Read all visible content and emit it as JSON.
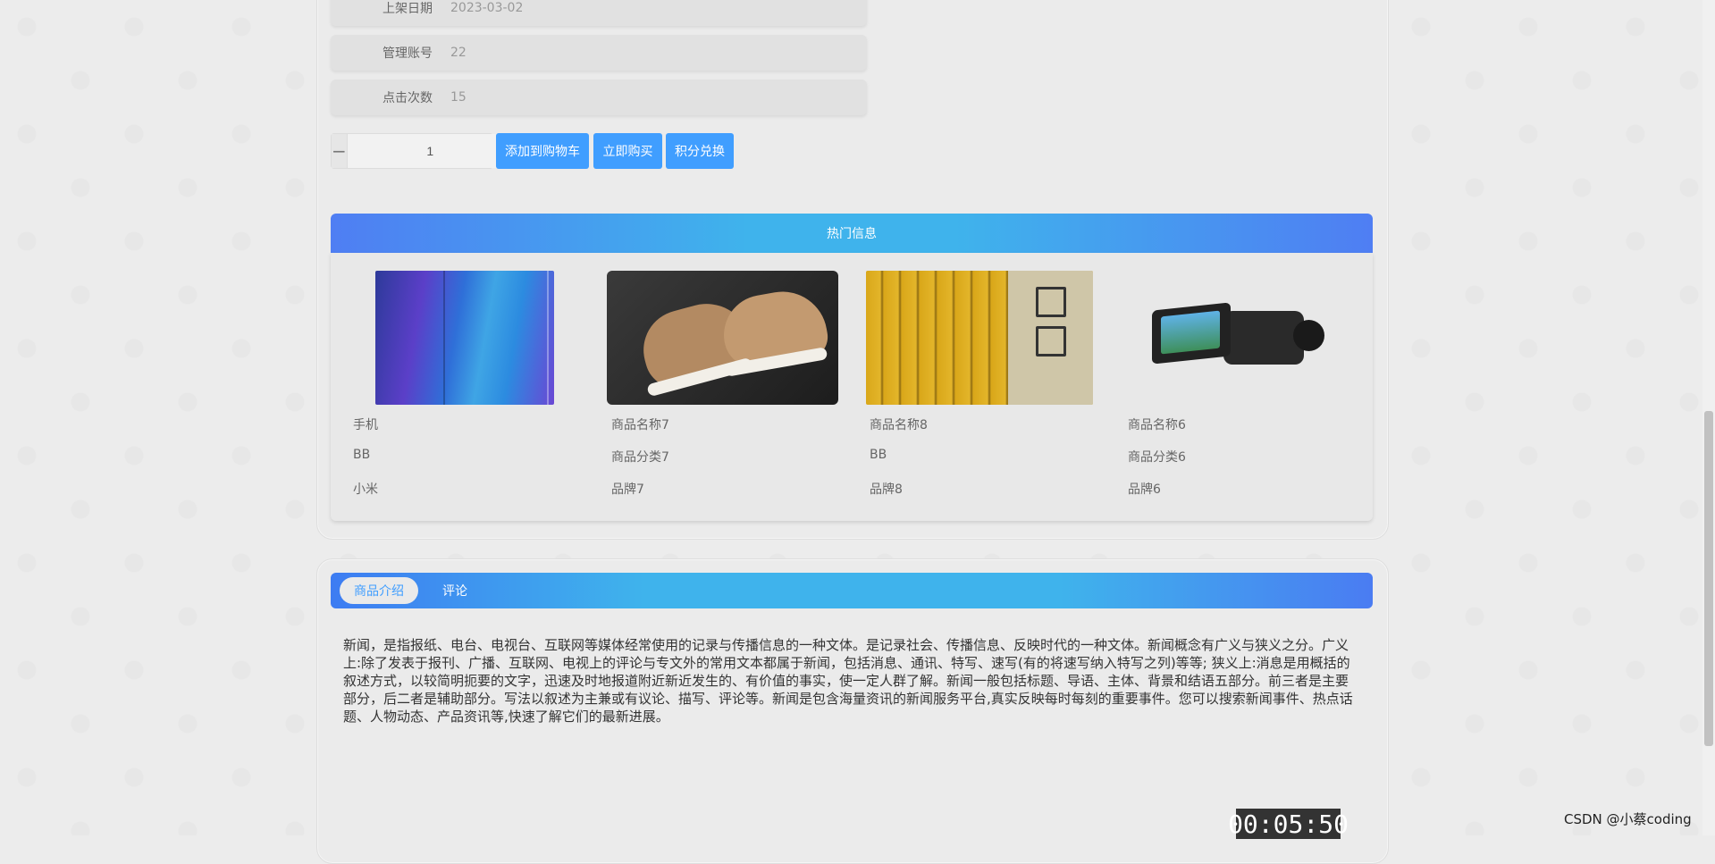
{
  "attributes": [
    {
      "label": "上架日期",
      "value": "2023-03-02"
    },
    {
      "label": "管理账号",
      "value": "22"
    },
    {
      "label": "点击次数",
      "value": "15"
    }
  ],
  "purchase": {
    "quantity": "1",
    "minus": "−",
    "plus": "+",
    "add_to_cart": "添加到购物车",
    "buy_now": "立即购买",
    "points_exchange": "积分兑换"
  },
  "hot": {
    "title": "热门信息",
    "items": [
      {
        "name": "手机",
        "category": "BB",
        "brand": "小米"
      },
      {
        "name": "商品名称7",
        "category": "商品分类7",
        "brand": "品牌7"
      },
      {
        "name": "商品名称8",
        "category": "BB",
        "brand": "品牌8"
      },
      {
        "name": "商品名称6",
        "category": "商品分类6",
        "brand": "品牌6"
      }
    ]
  },
  "tabs": {
    "intro": "商品介绍",
    "comments": "评论"
  },
  "description": "新闻，是指报纸、电台、电视台、互联网等媒体经常使用的记录与传播信息的一种文体。是记录社会、传播信息、反映时代的一种文体。新闻概念有广义与狭义之分。广义上:除了发表于报刊、广播、互联网、电视上的评论与专文外的常用文本都属于新闻，包括消息、通讯、特写、速写(有的将速写纳入特写之列)等等; 狭义上:消息是用概括的叙述方式，以较简明扼要的文字，迅速及时地报道附近新近发生的、有价值的事实，使一定人群了解。新闻一般包括标题、导语、主体、背景和结语五部分。前三者是主要部分，后二者是辅助部分。写法以叙述为主兼或有议论、描写、评论等。新闻是包含海量资讯的新闻服务平台,真实反映每时每刻的重要事件。您可以搜索新闻事件、热点话题、人物动态、产品资讯等,快速了解它们的最新进展。",
  "overlay": {
    "timer": "00:05:50",
    "watermark": "CSDN @小蔡coding"
  },
  "colors": {
    "primary": "#409eff",
    "gradient_start": "#4f7ef3",
    "gradient_mid": "#3fb3ec"
  }
}
